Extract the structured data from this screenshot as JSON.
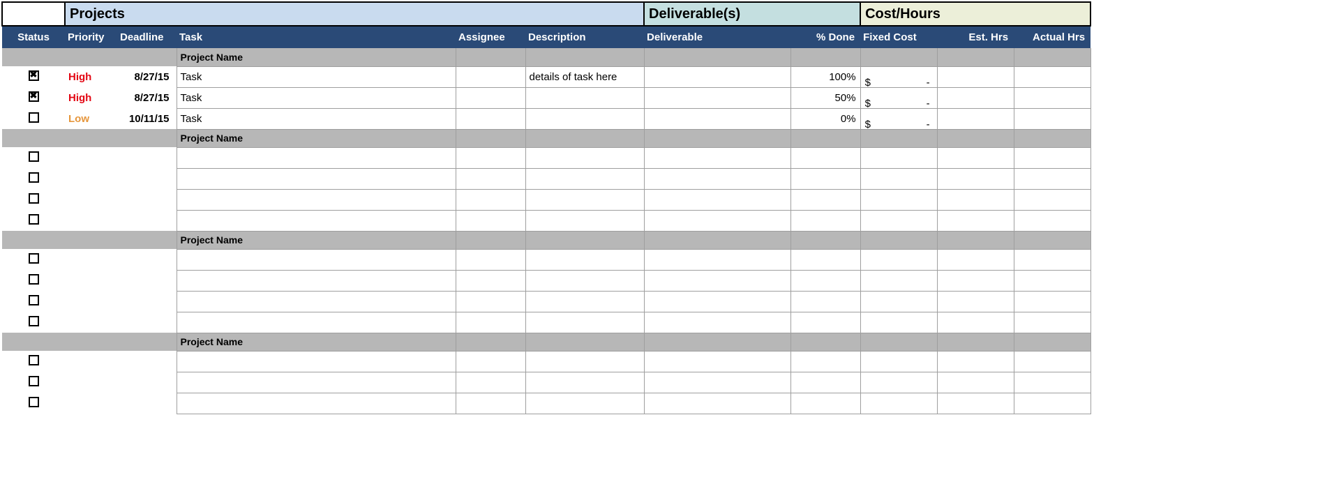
{
  "banners": {
    "projects": "Projects",
    "deliverables": "Deliverable(s)",
    "cost_hours": "Cost/Hours"
  },
  "columns": {
    "status": "Status",
    "priority": "Priority",
    "deadline": "Deadline",
    "task": "Task",
    "assignee": "Assignee",
    "description": "Description",
    "deliverable": "Deliverable",
    "pct_done": "% Done",
    "fixed_cost": "Fixed Cost",
    "est_hrs": "Est. Hrs",
    "actual_hrs": "Actual Hrs"
  },
  "sections": [
    {
      "title": "Project Name",
      "rows": [
        {
          "checked": true,
          "priority": "High",
          "priority_class": "high",
          "deadline": "8/27/15",
          "task": "Task",
          "assignee": "",
          "description": "details of task here",
          "deliverable": "",
          "pct_done": "100%",
          "fixed_cost_sym": "$",
          "fixed_cost_val": "-",
          "est_hrs": "",
          "actual_hrs": ""
        },
        {
          "checked": true,
          "priority": "High",
          "priority_class": "high",
          "deadline": "8/27/15",
          "task": "Task",
          "assignee": "",
          "description": "",
          "deliverable": "",
          "pct_done": "50%",
          "fixed_cost_sym": "$",
          "fixed_cost_val": "-",
          "est_hrs": "",
          "actual_hrs": ""
        },
        {
          "checked": false,
          "priority": "Low",
          "priority_class": "low",
          "deadline": "10/11/15",
          "task": "Task",
          "assignee": "",
          "description": "",
          "deliverable": "",
          "pct_done": "0%",
          "fixed_cost_sym": "$",
          "fixed_cost_val": "-",
          "est_hrs": "",
          "actual_hrs": ""
        }
      ]
    },
    {
      "title": "Project Name",
      "rows": [
        {
          "checked": false,
          "priority": "",
          "priority_class": "",
          "deadline": "",
          "task": "",
          "assignee": "",
          "description": "",
          "deliverable": "",
          "pct_done": "",
          "fixed_cost_sym": "",
          "fixed_cost_val": "",
          "est_hrs": "",
          "actual_hrs": ""
        },
        {
          "checked": false,
          "priority": "",
          "priority_class": "",
          "deadline": "",
          "task": "",
          "assignee": "",
          "description": "",
          "deliverable": "",
          "pct_done": "",
          "fixed_cost_sym": "",
          "fixed_cost_val": "",
          "est_hrs": "",
          "actual_hrs": ""
        },
        {
          "checked": false,
          "priority": "",
          "priority_class": "",
          "deadline": "",
          "task": "",
          "assignee": "",
          "description": "",
          "deliverable": "",
          "pct_done": "",
          "fixed_cost_sym": "",
          "fixed_cost_val": "",
          "est_hrs": "",
          "actual_hrs": ""
        },
        {
          "checked": false,
          "priority": "",
          "priority_class": "",
          "deadline": "",
          "task": "",
          "assignee": "",
          "description": "",
          "deliverable": "",
          "pct_done": "",
          "fixed_cost_sym": "",
          "fixed_cost_val": "",
          "est_hrs": "",
          "actual_hrs": ""
        }
      ]
    },
    {
      "title": "Project Name",
      "rows": [
        {
          "checked": false,
          "priority": "",
          "priority_class": "",
          "deadline": "",
          "task": "",
          "assignee": "",
          "description": "",
          "deliverable": "",
          "pct_done": "",
          "fixed_cost_sym": "",
          "fixed_cost_val": "",
          "est_hrs": "",
          "actual_hrs": ""
        },
        {
          "checked": false,
          "priority": "",
          "priority_class": "",
          "deadline": "",
          "task": "",
          "assignee": "",
          "description": "",
          "deliverable": "",
          "pct_done": "",
          "fixed_cost_sym": "",
          "fixed_cost_val": "",
          "est_hrs": "",
          "actual_hrs": ""
        },
        {
          "checked": false,
          "priority": "",
          "priority_class": "",
          "deadline": "",
          "task": "",
          "assignee": "",
          "description": "",
          "deliverable": "",
          "pct_done": "",
          "fixed_cost_sym": "",
          "fixed_cost_val": "",
          "est_hrs": "",
          "actual_hrs": ""
        },
        {
          "checked": false,
          "priority": "",
          "priority_class": "",
          "deadline": "",
          "task": "",
          "assignee": "",
          "description": "",
          "deliverable": "",
          "pct_done": "",
          "fixed_cost_sym": "",
          "fixed_cost_val": "",
          "est_hrs": "",
          "actual_hrs": ""
        }
      ]
    },
    {
      "title": "Project Name",
      "rows": [
        {
          "checked": false,
          "priority": "",
          "priority_class": "",
          "deadline": "",
          "task": "",
          "assignee": "",
          "description": "",
          "deliverable": "",
          "pct_done": "",
          "fixed_cost_sym": "",
          "fixed_cost_val": "",
          "est_hrs": "",
          "actual_hrs": ""
        },
        {
          "checked": false,
          "priority": "",
          "priority_class": "",
          "deadline": "",
          "task": "",
          "assignee": "",
          "description": "",
          "deliverable": "",
          "pct_done": "",
          "fixed_cost_sym": "",
          "fixed_cost_val": "",
          "est_hrs": "",
          "actual_hrs": ""
        },
        {
          "checked": false,
          "priority": "",
          "priority_class": "",
          "deadline": "",
          "task": "",
          "assignee": "",
          "description": "",
          "deliverable": "",
          "pct_done": "",
          "fixed_cost_sym": "",
          "fixed_cost_val": "",
          "est_hrs": "",
          "actual_hrs": ""
        }
      ]
    }
  ]
}
